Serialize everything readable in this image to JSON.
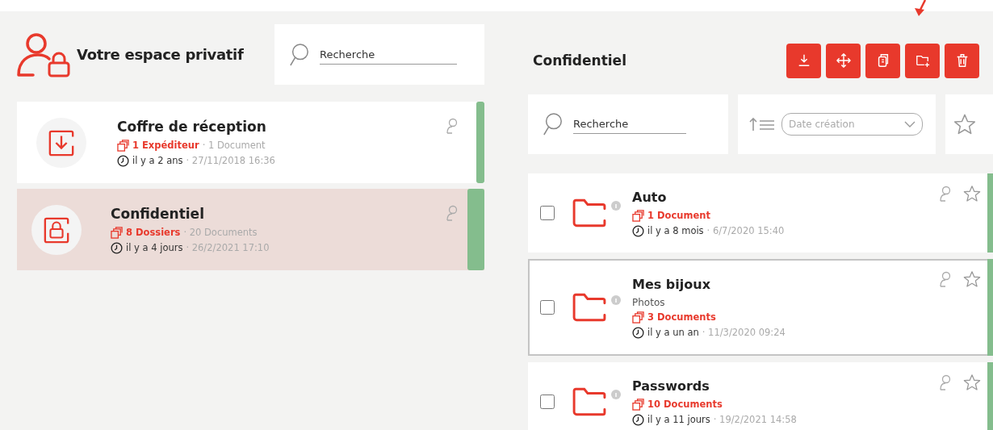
{
  "left": {
    "title": "Votre espace privatif",
    "search": {
      "placeholder": "Recherche"
    },
    "vaults": [
      {
        "kind": "inbox",
        "name": "Coffre de réception",
        "count": "1 Expéditeur",
        "meta": "· 1 Document",
        "age": "il y a 2 ans",
        "date": "· 27/11/2018 16:36",
        "selected": false
      },
      {
        "kind": "locked",
        "name": "Confidentiel",
        "count": "8 Dossiers",
        "meta": "· 20 Documents",
        "age": "il y a 4 jours",
        "date": "· 26/2/2021 17:10",
        "selected": true
      }
    ]
  },
  "right": {
    "title": "Confidentiel",
    "actions": [
      {
        "kind": "download"
      },
      {
        "kind": "move"
      },
      {
        "kind": "copy"
      },
      {
        "kind": "new-folder"
      },
      {
        "kind": "delete"
      }
    ],
    "search": {
      "placeholder": "Recherche"
    },
    "sort": {
      "placeholder": "Date création"
    },
    "folders": [
      {
        "name": "Auto",
        "count": "1 Document",
        "age": "il y a 8 mois",
        "date": "· 6/7/2020 15:40",
        "checked": false,
        "selected": false
      },
      {
        "name": "Mes bijoux",
        "subtitle": "Photos",
        "count": "3 Documents",
        "age": "il y a un an",
        "date": "· 11/3/2020 09:24",
        "checked": false,
        "selected": true
      },
      {
        "name": "Passwords",
        "count": "10 Documents",
        "age": "il y a 11 jours",
        "date": "· 19/2/2021 14:58",
        "checked": false,
        "selected": false
      }
    ]
  }
}
